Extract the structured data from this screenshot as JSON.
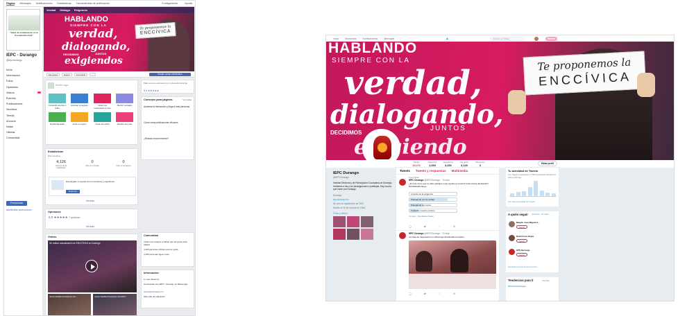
{
  "facebook": {
    "topnav": [
      "Página",
      "Mensajes",
      "Notificaciones",
      "Estadísticas",
      "Herramientas de publicación"
    ],
    "topnav_right": [
      "Configuración",
      "Ayuda"
    ],
    "page_pic_text": "\"Salas de actualización en la Escuela Electoral\"",
    "page_name": "IEPC - Durango",
    "page_handle": "@iepcdurango",
    "left_nav": [
      "Inicio",
      "Información",
      "Fotos",
      "Opiniones",
      "Videos",
      "Eventos",
      "Publicaciones",
      "Servicios",
      "Tienda",
      "Anuncio",
      "Notas",
      "Ofertas",
      "Comunidad"
    ],
    "promote_label": "Promocionar",
    "admin_label": "Administrar promociones",
    "cover_tabs": [
      "Verdad",
      "Diálogo",
      "Exigencia"
    ],
    "cover_main": "HABLANDO",
    "cover_sub": "SIEMPRE CON LA",
    "cover_words": [
      "verdad,",
      "dialogando,",
      "exigiendos"
    ],
    "cover_juntos": "JUNTOS",
    "cover_decidimos": "DECIDIMOS",
    "cover_paper1": "Te proponemos la",
    "cover_paper2": "ENCCÍVICA",
    "actions": [
      "Me gusta",
      "Seguir",
      "Compartir",
      "..."
    ],
    "send_msg": "Enviar correo electrónico",
    "composer_placeholder": "Escribe algo...",
    "tiles": [
      "Compartir una foto o video",
      "Anunciar tu negocio",
      "Iniciar una transmisión en vivo",
      "Recibir mensajes",
      "Recibir llamadas",
      "Crear un evento",
      "Crear una oferta",
      "Escribir una nota"
    ],
    "insights_title": "Estadísticas",
    "insights_sub": "Esta semana",
    "stats": [
      {
        "value": "4,126",
        "label": "Alcance de la publicación"
      },
      {
        "value": "0",
        "label": "Clics en el botón"
      },
      {
        "value": "0",
        "label": "Clics en la página"
      }
    ],
    "boost_text": "Has llegado a mejorar sus comentarios y seguidores",
    "boost_btn": "Empezar",
    "see_all": "Ver todo",
    "opinions_title": "Opiniones",
    "rating": "5.0",
    "rating_count": "7 opiniones",
    "videos_title": "Videos",
    "video1_title": "Se realizó actualización de ENCCÍVICA en Durango",
    "video2_title": "Jesús Padilla Presidente del ...",
    "video3_title": "Jesús Padilla Presidente del IEPC",
    "right_title1": "Más cerca de educación en cultura de Durango",
    "right_rating": "5.0 ★★★★★",
    "connect_title": "Consejos para páginas",
    "connect_see": "Ver todos",
    "tips": [
      "Aumenta la interacción y llega a más personas",
      "Cómo crear publicaciones eficaces",
      "¿Buscas una promoción?"
    ],
    "community_title": "Comunidad",
    "community_items": [
      "Invita a tus amigos a indicar que les gusta esta página",
      "4,115 personas indican que les gusta",
      "4,185 personas siguen esto"
    ],
    "about_title": "Información",
    "about_items": [
      "Lo que hacemos",
      "Comunícate con IEPC - Durango en Messenger",
      "www.iepcdurango.mx",
      "Sitio web de educación"
    ]
  },
  "twitter": {
    "nav": [
      "Inicio",
      "Momentos",
      "Notificaciones",
      "Mensajes"
    ],
    "search_placeholder": "Buscar en Twitter",
    "tweet_btn": "Twittear",
    "banner_line1": "HABLANDO",
    "banner_line2": "SIEMPRE CON LA",
    "banner_word1": "verdad,",
    "banner_word2": "dialogando,",
    "banner_juntos": "JUNTOS",
    "banner_decidimos": "DECIDIMOS",
    "banner_exig": "exigiendo",
    "paper_line1": "Te proponemos la",
    "paper_line2": "ENCCÍVICA",
    "stats": [
      {
        "label": "Tweets",
        "value": "15,3 K"
      },
      {
        "label": "Siguiendo",
        "value": "1,053"
      },
      {
        "label": "Seguidores",
        "value": "4,291"
      },
      {
        "label": "Me gusta",
        "value": "3,126"
      },
      {
        "label": "Momentos",
        "value": "2"
      }
    ],
    "edit_profile": "Editar perfil",
    "profile_name": "IEPC Durango",
    "profile_handle": "@IEPCDurango",
    "profile_bio": "Instituto Electoral y de Participación Ciudadana de Durango. Invitamos a las y los duranguenses a participar. Hay mucho que hacer por Durango.",
    "profile_loc": "Durango",
    "profile_url": "iepcdurango.mx",
    "profile_joined": "Se unió en septiembre de 2013",
    "profile_birth": "Nacido el 20 de octubre de 1994",
    "profile_photos": "Fotos y videos",
    "tabs": [
      "Tweets",
      "Tweets y respuestas",
      "Multimedia"
    ],
    "pinned_label": "Tweet fijado",
    "tweet1_name": "IEPC Durango",
    "tweet1_handle": "@IEPCDurango · 19 sept.",
    "tweet1_text": "¿En qué crees que se debe trabajar a que ayudes a construir la Enccivica del Estado? #VotaParaDurango",
    "poll": [
      "A través de la exigencia",
      "Dialogando con la verdad",
      "Dialogando con todos",
      "Cuidando nuestro entorno"
    ],
    "poll_votes": "11 votos · Resultados finales",
    "tweet2_name": "IEPC Durango",
    "tweet2_handle": "@IEPCDurango · 20 sept.",
    "tweet2_text": "Jornada de capacitación en #Durango #CulturaDemocrática",
    "activity_title": "Tu actividad de Tweets",
    "activity_text": "Tus Tweets consiguieron 4,758 impresiones durante los últimos 28 días",
    "activity_link": "Ver toda la actividad de Tweets",
    "activity_bars": [
      0.15,
      0.25,
      0.3,
      0.55,
      0.9,
      0.35,
      0.2,
      0.15
    ],
    "who_title": "A quién seguir",
    "who_update": "Actualizar",
    "who_see_all": "Ver todos",
    "who": [
      {
        "name": "Magdá. José Miguel C...",
        "follow": "Seguir"
      },
      {
        "name": "Raúl Flores Rojas",
        "follow": "Seguir"
      },
      {
        "name": "OPE Durango",
        "follow": "Seguir"
      }
    ],
    "who_more": "Encuentra personas que conoces",
    "trends_title": "Tendencias para ti",
    "trends_change": "Cambiar",
    "trend_item": "#DerechoDurango"
  },
  "colors": {
    "fb_blue": "#4267b2",
    "magenta": "#d81b60",
    "tw_blue": "#1da1f2"
  }
}
